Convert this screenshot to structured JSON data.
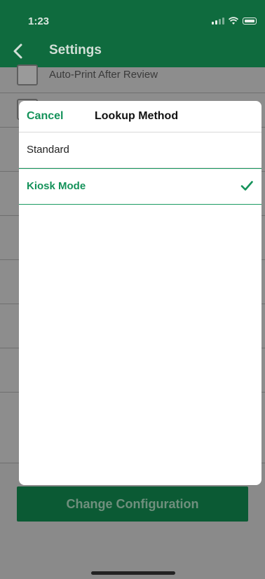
{
  "status_bar": {
    "time": "1:23"
  },
  "nav": {
    "title": "Settings"
  },
  "background": {
    "first_setting_label": "Auto-Print After Review",
    "change_configuration_label": "Change Configuration"
  },
  "picker": {
    "cancel_label": "Cancel",
    "title": "Lookup Method",
    "options": [
      {
        "label": "Standard",
        "selected": false
      },
      {
        "label": "Kiosk Mode",
        "selected": true
      }
    ]
  },
  "colors": {
    "brand_green": "#14925a",
    "header_green_dimmed": "#0f6b3e"
  }
}
